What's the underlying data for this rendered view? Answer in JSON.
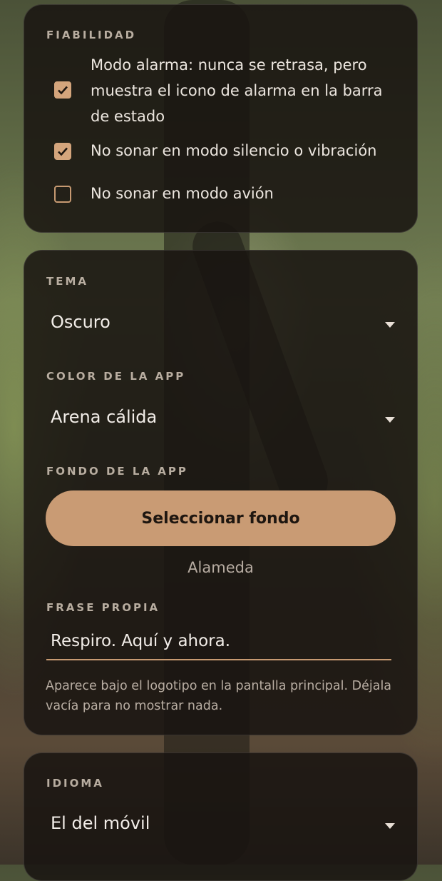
{
  "reliability": {
    "label": "FIABILIDAD",
    "options": [
      {
        "text": "Modo alarma: nunca se retrasa, pero muestra el icono de alarma en la barra de estado",
        "checked": true
      },
      {
        "text": "No sonar en modo silencio o vibración",
        "checked": true
      },
      {
        "text": "No sonar en modo avión",
        "checked": false
      }
    ]
  },
  "appearance": {
    "theme_label": "TEMA",
    "theme_value": "Oscuro",
    "color_label": "COLOR DE LA APP",
    "color_value": "Arena cálida",
    "background_label": "FONDO DE LA APP",
    "background_button": "Seleccionar fondo",
    "background_current": "Alameda",
    "phrase_label": "FRASE PROPIA",
    "phrase_value": "Respiro. Aquí y ahora.",
    "phrase_helper": "Aparece bajo el logotipo en la pantalla principal. Déjala vacía para no mostrar nada."
  },
  "language": {
    "label": "IDIOMA",
    "value": "El del móvil"
  },
  "colors": {
    "accent": "#c99b74",
    "card_background": "#181410",
    "text_primary": "#f2ede8",
    "text_secondary": "#b8ada0"
  },
  "icons": {
    "checkbox_checked": "check-icon",
    "dropdown": "caret-down-icon"
  }
}
